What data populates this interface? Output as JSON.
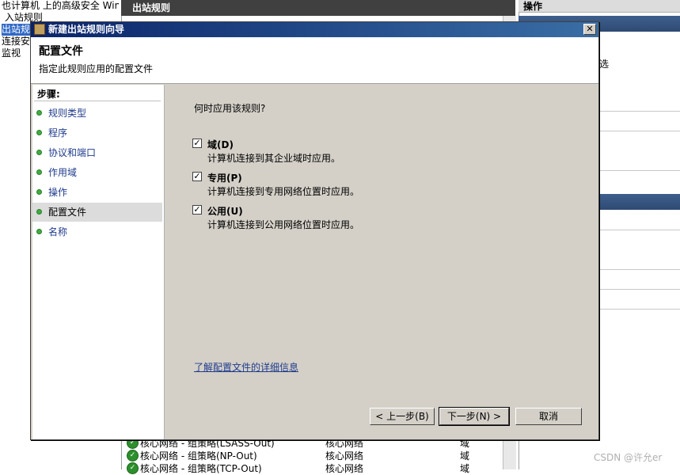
{
  "background": {
    "tree_items": [
      "也计算机 上的高级安全 Windo",
      "入站规则",
      "出站规则",
      "连接安全",
      "监视"
    ],
    "center_header": "出站规则",
    "right_header": "操作",
    "right_item_text": "选",
    "rules": [
      {
        "name": "核心网络 - 组策略(LSASS-Out)",
        "group": "核心网络",
        "profile": "域"
      },
      {
        "name": "核心网络 - 组策略(NP-Out)",
        "group": "核心网络",
        "profile": "域"
      },
      {
        "name": "核心网络 - 组策略(TCP-Out)",
        "group": "核心网络",
        "profile": "域"
      }
    ]
  },
  "dialog": {
    "title": "新建出站规则向导",
    "header_title": "配置文件",
    "header_subtitle": "指定此规则应用的配置文件",
    "steps_label": "步骤:",
    "steps": [
      "规则类型",
      "程序",
      "协议和端口",
      "作用域",
      "操作",
      "配置文件",
      "名称"
    ],
    "active_step_index": 5,
    "question": "何时应用该规则?",
    "profiles": [
      {
        "label": "域(D)",
        "description": "计算机连接到其企业域时应用。",
        "checked": true
      },
      {
        "label": "专用(P)",
        "description": "计算机连接到专用网络位置时应用。",
        "checked": true
      },
      {
        "label": "公用(U)",
        "description": "计算机连接到公用网络位置时应用。",
        "checked": true
      }
    ],
    "learn_more_link": "了解配置文件的详细信息",
    "buttons": {
      "back": "< 上一步(B)",
      "next": "下一步(N) >",
      "cancel": "取消"
    },
    "close_glyph": "✕"
  },
  "watermark": "CSDN @许允er"
}
